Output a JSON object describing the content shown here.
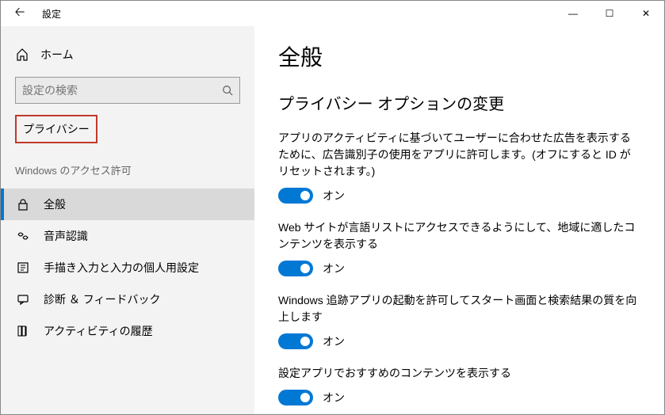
{
  "titlebar": {
    "title": "設定"
  },
  "sidebar": {
    "home_label": "ホーム",
    "search_placeholder": "設定の検索",
    "category": "プライバシー",
    "section_label": "Windows のアクセス許可",
    "items": [
      {
        "label": "全般"
      },
      {
        "label": "音声認識"
      },
      {
        "label": "手描き入力と入力の個人用設定"
      },
      {
        "label": "診断 ＆ フィードバック"
      },
      {
        "label": "アクティビティの履歴"
      }
    ]
  },
  "content": {
    "page_title": "全般",
    "sub_heading": "プライバシー オプションの変更",
    "options": [
      {
        "desc": "アプリのアクティビティに基づいてユーザーに合わせた広告を表示するために、広告識別子の使用をアプリに許可します。(オフにすると ID がリセットされます。)",
        "state": "オン"
      },
      {
        "desc": "Web サイトが言語リストにアクセスできるようにして、地域に適したコンテンツを表示する",
        "state": "オン"
      },
      {
        "desc": "Windows 追跡アプリの起動を許可してスタート画面と検索結果の質を向上します",
        "state": "オン"
      },
      {
        "desc": "設定アプリでおすすめのコンテンツを表示する",
        "state": "オン"
      }
    ]
  }
}
